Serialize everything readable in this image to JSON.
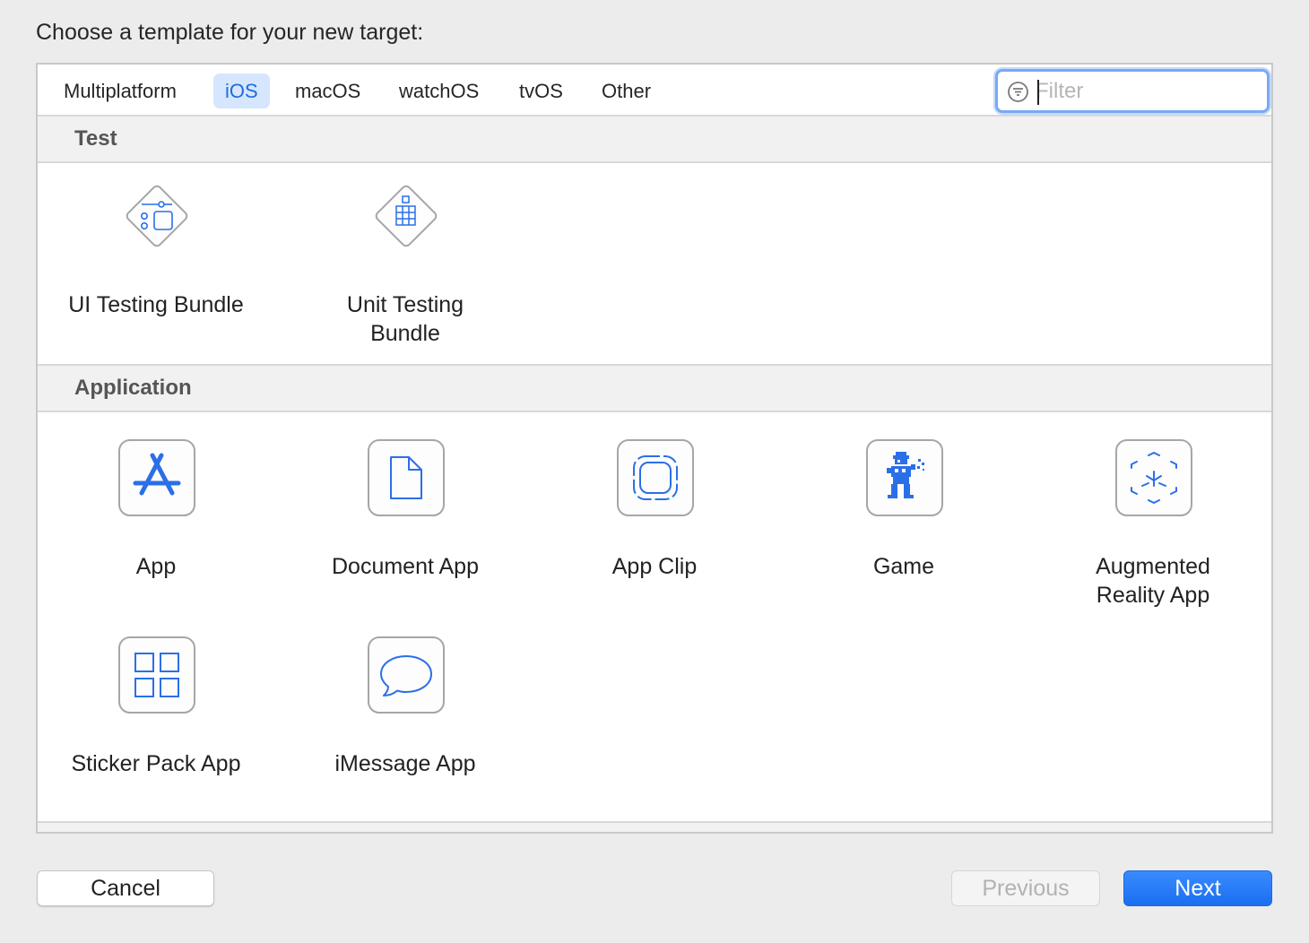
{
  "dialog": {
    "title": "Choose a template for your new target:"
  },
  "tabs": [
    {
      "label": "Multiplatform",
      "active": false
    },
    {
      "label": "iOS",
      "active": true
    },
    {
      "label": "macOS",
      "active": false
    },
    {
      "label": "watchOS",
      "active": false
    },
    {
      "label": "tvOS",
      "active": false
    },
    {
      "label": "Other",
      "active": false
    }
  ],
  "filter": {
    "placeholder": "Filter",
    "value": ""
  },
  "sections": [
    {
      "title": "Test",
      "items": [
        {
          "label": "UI Testing Bundle",
          "icon": "ui-testing-bundle-icon"
        },
        {
          "label": "Unit Testing\nBundle",
          "icon": "unit-testing-bundle-icon"
        }
      ]
    },
    {
      "title": "Application",
      "items": [
        {
          "label": "App",
          "icon": "app-store-icon"
        },
        {
          "label": "Document App",
          "icon": "document-icon"
        },
        {
          "label": "App Clip",
          "icon": "app-clip-icon"
        },
        {
          "label": "Game",
          "icon": "game-sprite-icon"
        },
        {
          "label": "Augmented\nReality App",
          "icon": "ar-cube-icon"
        },
        {
          "label": "Sticker Pack App",
          "icon": "sticker-grid-icon"
        },
        {
          "label": "iMessage App",
          "icon": "message-bubble-icon"
        }
      ]
    }
  ],
  "buttons": {
    "cancel": "Cancel",
    "previous": "Previous",
    "next": "Next"
  },
  "colors": {
    "accent": "#1f6ce0",
    "icon_blue": "#2b6fe8",
    "selected_tab_bg": "#d6e6ff"
  }
}
